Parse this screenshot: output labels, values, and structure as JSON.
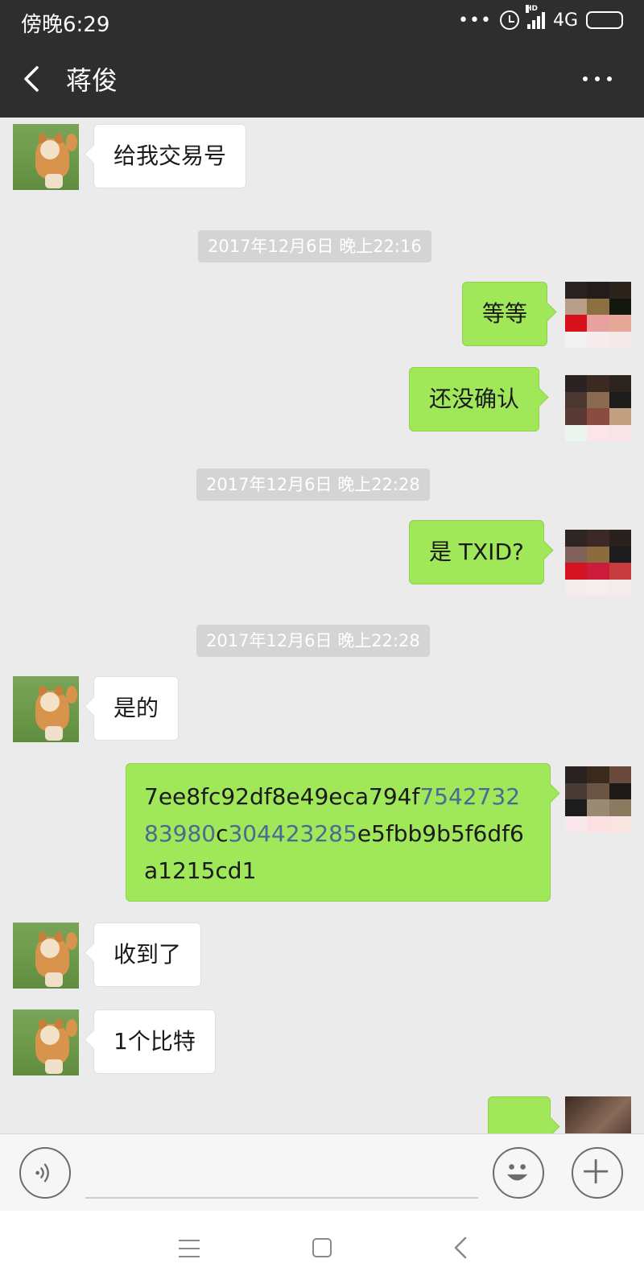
{
  "status_bar": {
    "time": "傍晚6:29",
    "signal_indicator": "HD",
    "network": "4G"
  },
  "header": {
    "title": "蒋俊",
    "back_icon": "chevron-left-icon",
    "more_icon": "more-dots-icon"
  },
  "messages": [
    {
      "type": "received",
      "text": "给我交易号"
    },
    {
      "type": "timestamp",
      "text": "2017年12月6日 晚上22:16"
    },
    {
      "type": "sent",
      "text": "等等"
    },
    {
      "type": "sent",
      "text": "还没确认"
    },
    {
      "type": "timestamp",
      "text": "2017年12月6日 晚上22:28"
    },
    {
      "type": "sent",
      "text": "是 TXID?"
    },
    {
      "type": "timestamp",
      "text": "2017年12月6日 晚上22:28"
    },
    {
      "type": "received",
      "text": "是的"
    },
    {
      "type": "sent",
      "text": "7ee8fc92df8e49eca794f754273283980c304423285e5fbb9b5f6df6a1215cd1",
      "parts": [
        "7ee8fc92df8e49eca794f",
        "754273283980",
        "c",
        "304423285",
        "e5fbb9b5f6df6a1215cd1"
      ]
    },
    {
      "type": "received",
      "text": "收到了"
    },
    {
      "type": "received",
      "text": "1个比特"
    }
  ],
  "input_bar": {
    "voice_icon": "voice-icon",
    "emoji_icon": "emoji-icon",
    "plus_icon": "plus-icon"
  },
  "colors": {
    "header_bg": "#2e2e2e",
    "chat_bg": "#ebebeb",
    "sent_bubble": "#a0e75a",
    "received_bubble": "#ffffff",
    "link": "#4a6a93"
  }
}
